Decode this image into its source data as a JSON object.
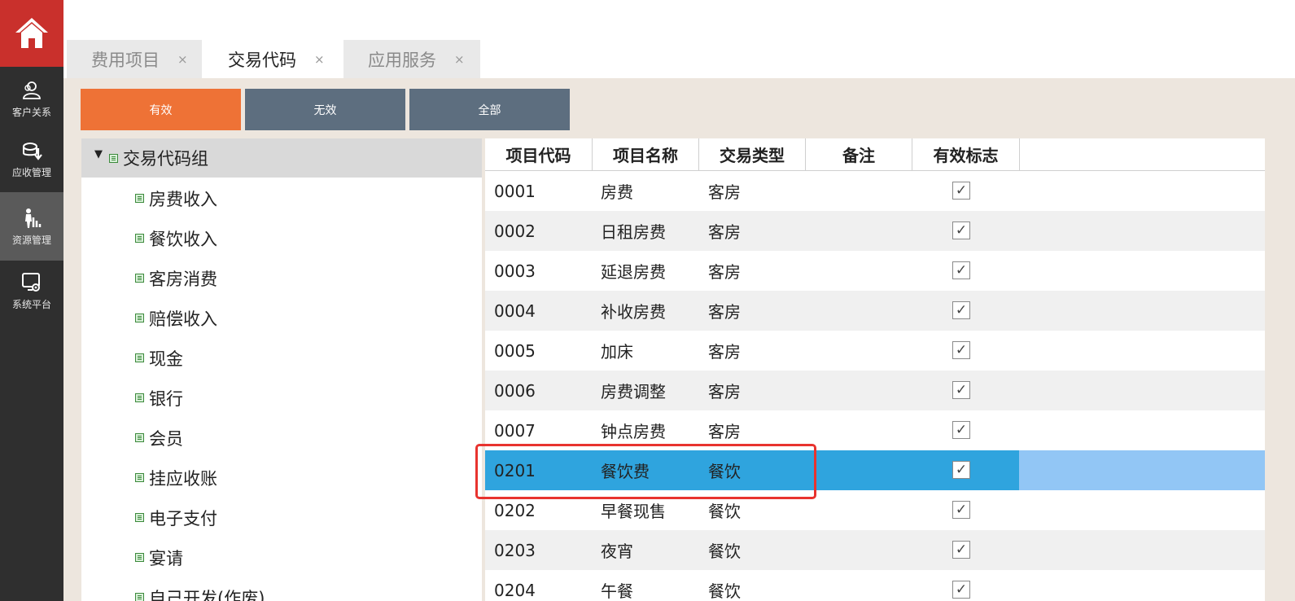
{
  "nav": {
    "items": [
      {
        "label": "客户关系",
        "icon": "customer-relations-icon"
      },
      {
        "label": "应收管理",
        "icon": "receivables-icon"
      },
      {
        "label": "资源管理",
        "icon": "resource-management-icon"
      },
      {
        "label": "系统平台",
        "icon": "system-platform-icon"
      }
    ]
  },
  "tabs": [
    {
      "label": "费用项目",
      "close": "×"
    },
    {
      "label": "交易代码",
      "close": "×"
    },
    {
      "label": "应用服务",
      "close": "×"
    }
  ],
  "filters": [
    "有效",
    "无效",
    "全部"
  ],
  "tree": {
    "root_label": "交易代码组",
    "items": [
      "房费收入",
      "餐饮收入",
      "客房消费",
      "赔偿收入",
      "现金",
      "银行",
      "会员",
      "挂应收账",
      "电子支付",
      "宴请",
      "自己开发(作废)"
    ]
  },
  "grid": {
    "columns": [
      "项目代码",
      "项目名称",
      "交易类型",
      "备注",
      "有效标志"
    ],
    "rows": [
      {
        "code": "0001",
        "name": "房费",
        "type": "客房",
        "note": "",
        "valid": "✓"
      },
      {
        "code": "0002",
        "name": "日租房费",
        "type": "客房",
        "note": "",
        "valid": "✓"
      },
      {
        "code": "0003",
        "name": "延退房费",
        "type": "客房",
        "note": "",
        "valid": "✓"
      },
      {
        "code": "0004",
        "name": "补收房费",
        "type": "客房",
        "note": "",
        "valid": "✓"
      },
      {
        "code": "0005",
        "name": "加床",
        "type": "客房",
        "note": "",
        "valid": "✓"
      },
      {
        "code": "0006",
        "name": "房费调整",
        "type": "客房",
        "note": "",
        "valid": "✓"
      },
      {
        "code": "0007",
        "name": "钟点房费",
        "type": "客房",
        "note": "",
        "valid": "✓"
      },
      {
        "code": "0201",
        "name": "餐饮费",
        "type": "餐饮",
        "note": "",
        "valid": "✓"
      },
      {
        "code": "0202",
        "name": "早餐现售",
        "type": "餐饮",
        "note": "",
        "valid": "✓"
      },
      {
        "code": "0203",
        "name": "夜宵",
        "type": "餐饮",
        "note": "",
        "valid": "✓"
      },
      {
        "code": "0204",
        "name": "午餐",
        "type": "餐饮",
        "note": "",
        "valid": "✓"
      }
    ]
  },
  "colors": {
    "home_red": "#c9302c",
    "active_filter": "#ee7236",
    "filter": "#5d6e7f",
    "selected_row": "#2fa4de",
    "selected_row_tail": "#92c6f5",
    "highlight_box": "#e8332f"
  }
}
